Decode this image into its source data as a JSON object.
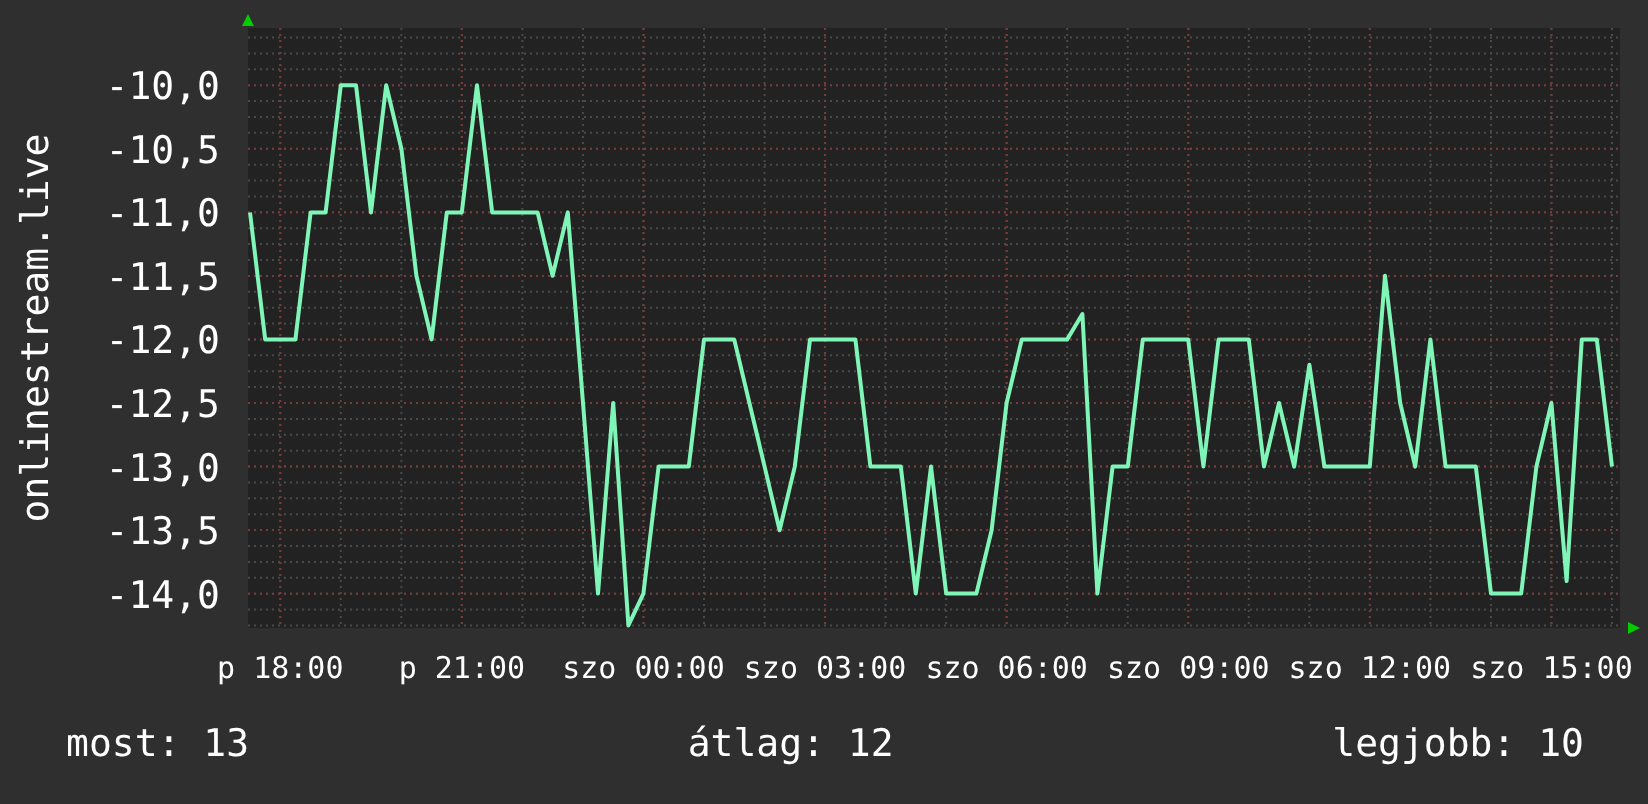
{
  "chart_data": {
    "type": "line",
    "grid": true,
    "ylabel": "onlinestream.live",
    "ylim": [
      -14.27,
      -9.55
    ],
    "yticks": [
      {
        "value": -10,
        "label": "-10,0"
      },
      {
        "value": -10.5,
        "label": "-10,5"
      },
      {
        "value": -11,
        "label": "-11,0"
      },
      {
        "value": -11.5,
        "label": "-11,5"
      },
      {
        "value": -12,
        "label": "-12,0"
      },
      {
        "value": -12.5,
        "label": "-12,5"
      },
      {
        "value": -13,
        "label": "-13,0"
      },
      {
        "value": -13.5,
        "label": "-13,5"
      },
      {
        "value": -14,
        "label": "-14,0"
      }
    ],
    "categories": [
      null,
      null,
      "p 18:00",
      null,
      null,
      null,
      null,
      null,
      null,
      null,
      null,
      null,
      null,
      null,
      "p 21:00",
      null,
      null,
      null,
      null,
      null,
      null,
      null,
      null,
      null,
      null,
      null,
      "szo 00:00",
      null,
      null,
      null,
      null,
      null,
      null,
      null,
      null,
      null,
      null,
      null,
      "szo 03:00",
      null,
      null,
      null,
      null,
      null,
      null,
      null,
      null,
      null,
      null,
      null,
      "szo 06:00",
      null,
      null,
      null,
      null,
      null,
      null,
      null,
      null,
      null,
      null,
      null,
      "szo 09:00",
      null,
      null,
      null,
      null,
      null,
      null,
      null,
      null,
      null,
      null,
      null,
      "szo 12:00",
      null,
      null,
      null,
      null,
      null,
      null,
      null,
      null,
      null,
      null,
      null,
      "szo 15:00",
      null,
      null,
      null,
      null
    ],
    "series": [
      {
        "color": "#7ff5b8",
        "values": [
          -11,
          -12,
          -12,
          -12,
          -11,
          -11,
          -10,
          -10,
          -11,
          -10,
          -10.5,
          -11.5,
          -12,
          -11,
          -11,
          -10,
          -11,
          -11,
          -11,
          -11,
          -11.5,
          -11,
          -12.5,
          -14,
          -12.5,
          -14.25,
          -14,
          -13,
          -13,
          -13,
          -12,
          -12,
          -12,
          -12.5,
          -13,
          -13.5,
          -13,
          -12,
          -12,
          -12,
          -12,
          -13,
          -13,
          -13,
          -14,
          -13,
          -14,
          -14,
          -14,
          -13.5,
          -12.5,
          -12,
          -12,
          -12,
          -12,
          -11.8,
          -14,
          -13,
          -13,
          -12,
          -12,
          -12,
          -12,
          -13,
          -12,
          -12,
          -12,
          -13,
          -12.5,
          -13,
          -12.2,
          -13,
          -13,
          -13,
          -13,
          -11.5,
          -12.5,
          -13,
          -12,
          -13,
          -13,
          -13,
          -14,
          -14,
          -14,
          -13,
          -12.5,
          -13.9,
          -12,
          -12,
          -13
        ]
      }
    ]
  },
  "legend": [
    {
      "label": "most:",
      "value": "13"
    },
    {
      "label": "átlag:",
      "value": "12"
    },
    {
      "label": "legjobb:",
      "value": "10"
    }
  ]
}
